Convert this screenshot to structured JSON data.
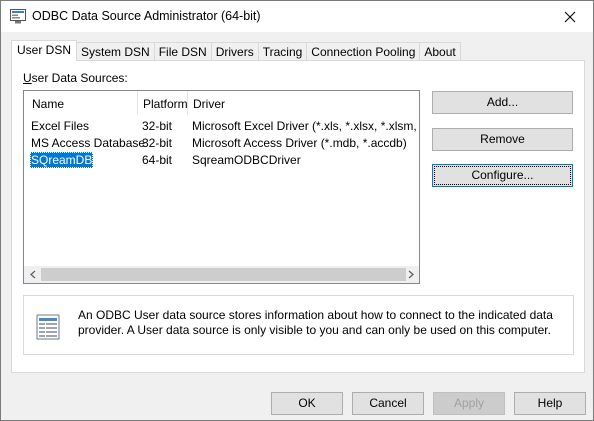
{
  "window": {
    "title": "ODBC Data Source Administrator (64-bit)",
    "close_glyph": "✕"
  },
  "tabs": [
    {
      "label": "User DSN",
      "active": true
    },
    {
      "label": "System DSN",
      "active": false
    },
    {
      "label": "File DSN",
      "active": false
    },
    {
      "label": "Drivers",
      "active": false
    },
    {
      "label": "Tracing",
      "active": false
    },
    {
      "label": "Connection Pooling",
      "active": false
    },
    {
      "label": "About",
      "active": false
    }
  ],
  "user_dsn": {
    "group_label": "User Data Sources:",
    "columns": [
      "Name",
      "Platform",
      "Driver"
    ],
    "rows": [
      {
        "name": "Excel Files",
        "platform": "32-bit",
        "driver": "Microsoft Excel Driver (*.xls, *.xlsx, *.xlsm, *.xlsb)",
        "selected": false
      },
      {
        "name": "MS Access Database",
        "platform": "32-bit",
        "driver": "Microsoft Access Driver (*.mdb, *.accdb)",
        "selected": false
      },
      {
        "name": "SQreamDB",
        "platform": "64-bit",
        "driver": "SqreamODBCDriver",
        "selected": true
      }
    ],
    "buttons": {
      "add": "Add...",
      "remove": "Remove",
      "configure": "Configure..."
    },
    "info_text": "An ODBC User data source stores information about how to connect to the indicated data provider.   A User data source is only visible to you and can only be used on this computer."
  },
  "footer": {
    "ok": "OK",
    "cancel": "Cancel",
    "apply": "Apply",
    "help": "Help"
  },
  "colors": {
    "selection": "#0078d7",
    "focus_border": "#0078d7",
    "panel_bg": "#ffffff",
    "window_bg": "#f0f0f0"
  },
  "icons": {
    "title": "odbc-admin-icon",
    "info": "data-source-icon"
  }
}
